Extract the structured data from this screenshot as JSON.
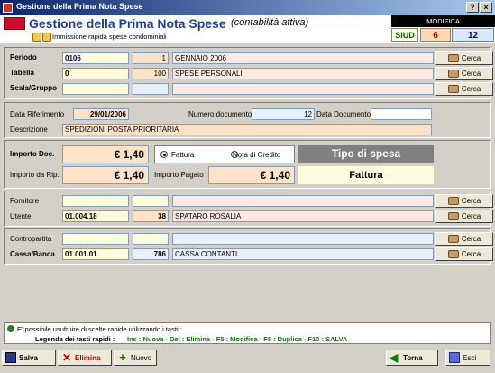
{
  "window": {
    "title": "Gestione della Prima Nota Spese"
  },
  "header": {
    "title": "Gestione della Prima Nota Spese",
    "subtitle": "(contabilità attiva)",
    "description": "Immissione rapida spese condominiali",
    "mode": "MODIFICA",
    "siud_label": "SIUD",
    "siud_value": "6",
    "siud_value2": "12"
  },
  "form": {
    "periodo": {
      "label": "Periodo",
      "code": "0106",
      "num": "1",
      "desc": "GENNAIO 2006"
    },
    "tabella": {
      "label": "Tabella",
      "code": "0",
      "num": "100",
      "desc": "SPESE PERSONALI"
    },
    "scala": {
      "label": "Scala/Gruppo",
      "code": "",
      "num": "",
      "desc": ""
    },
    "cerca_label": "Cerca",
    "data_rif_label": "Data Riferimento",
    "data_rif": "29/01/2006",
    "num_doc_label": "Numero documento",
    "num_doc": "12",
    "data_doc_label": "Data Documento",
    "data_doc": "",
    "descrizione_label": "Descrizione",
    "descrizione": "SPEDIZIONI POSTA PRIORITARIA",
    "importo_doc_label": "Importo Doc.",
    "importo_doc": "€ 1,40",
    "fattura_label": "Fattura",
    "nota_label": "Nota di Credito",
    "tipo_spesa_label": "Tipo di spesa",
    "importo_rip_label": "Importo da Rip.",
    "importo_rip": "€ 1,40",
    "importo_pagato_label": "Importo Pagato",
    "importo_pagato": "€ 1,40",
    "tipo_spesa_value": "Fattura",
    "fornitore": {
      "label": "Fornitore",
      "code": "",
      "num": "",
      "desc": ""
    },
    "utente": {
      "label": "Utente",
      "code": "01.004.18",
      "num": "38",
      "desc": "SPATARO ROSALIA"
    },
    "contropartita": {
      "label": "Contropartita",
      "code": "",
      "num": "",
      "desc": ""
    },
    "cassa": {
      "label": "Cassa/Banca",
      "code": "01.001.01",
      "num": "786",
      "desc": "CASSA CONTANTI"
    }
  },
  "info": {
    "line1": "E' possibile usufruire di scelte rapide utilizzando i tasti :",
    "line2_label": "Legenda dei tasti rapidi :",
    "line2_keys": "Ins : Nuova - Del : Elimina - F5 : Modifica - F8 : Duplica - F10 : SALVA"
  },
  "toolbar": {
    "salva": "Salva",
    "elimina": "Elimina",
    "nuovo": "Nuovo",
    "torna": "Torna",
    "esci": "Esci"
  },
  "colors": {
    "accent": "#1f3f9a",
    "keys": "#008000"
  }
}
